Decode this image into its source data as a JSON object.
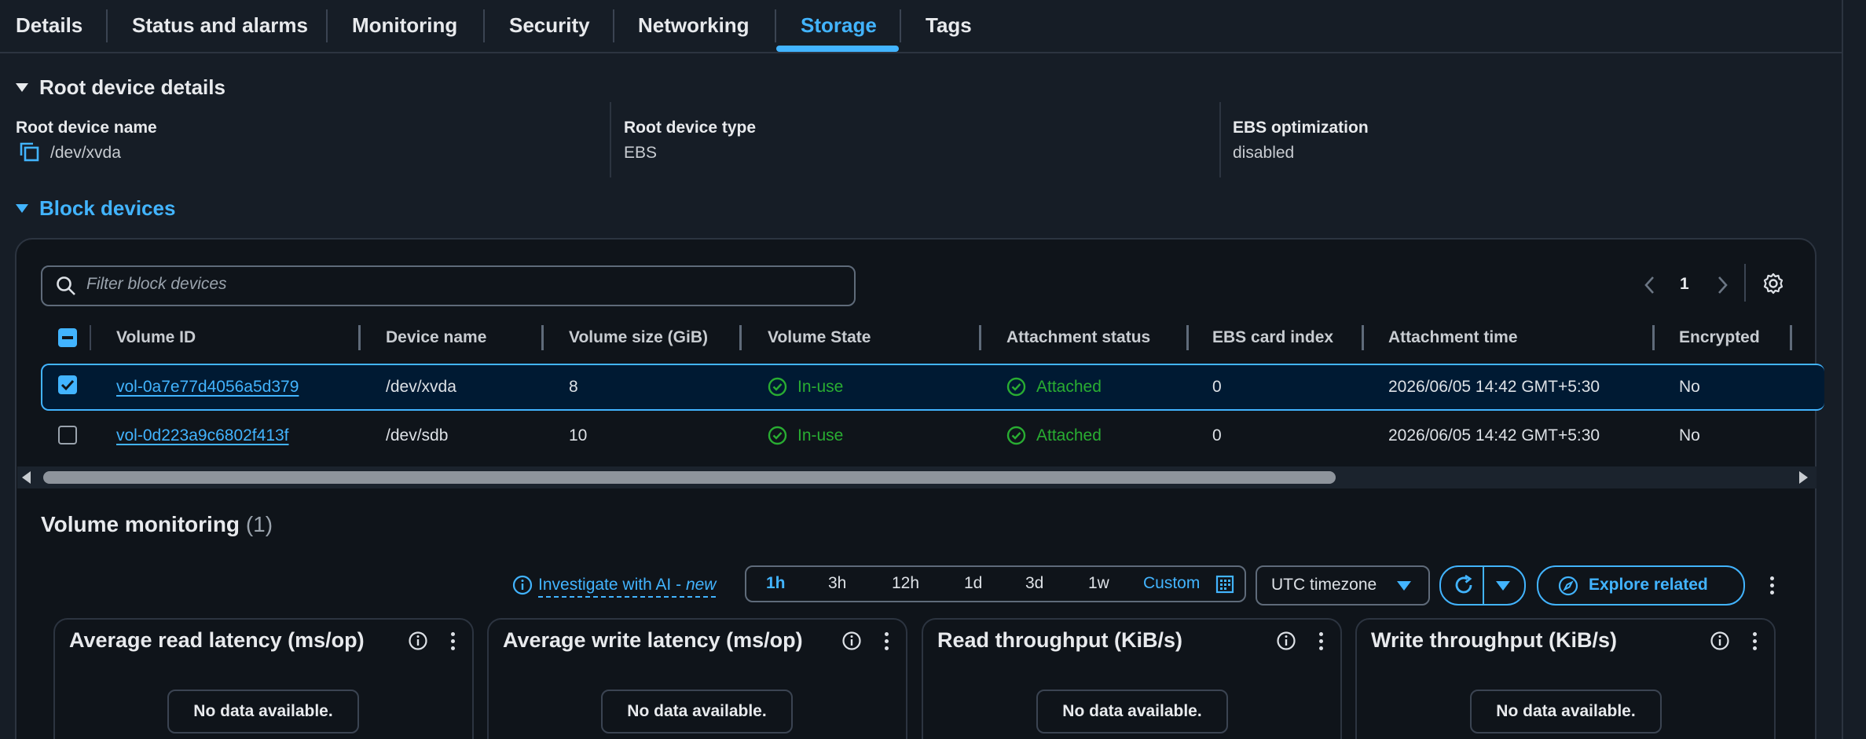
{
  "tabs": [
    {
      "label": "Details"
    },
    {
      "label": "Status and alarms"
    },
    {
      "label": "Monitoring"
    },
    {
      "label": "Security"
    },
    {
      "label": "Networking"
    },
    {
      "label": "Storage",
      "active": true
    },
    {
      "label": "Tags"
    }
  ],
  "root_device": {
    "title": "Root device details",
    "fields": [
      {
        "label": "Root device name",
        "value": "/dev/xvda"
      },
      {
        "label": "Root device type",
        "value": "EBS"
      },
      {
        "label": "EBS optimization",
        "value": "disabled"
      }
    ]
  },
  "block_devices": {
    "title": "Block devices",
    "search_placeholder": "Filter block devices",
    "page": "1",
    "columns": [
      "Volume ID",
      "Device name",
      "Volume size (GiB)",
      "Volume State",
      "Attachment status",
      "EBS card index",
      "Attachment time",
      "Encrypted"
    ],
    "rows": [
      {
        "selected": true,
        "volume_id": "vol-0a7e77d4056a5d379",
        "device": "/dev/xvda",
        "size": "8",
        "state": "In-use",
        "attachment": "Attached",
        "card_index": "0",
        "time": "2026/06/05 14:42 GMT+5:30",
        "encrypted": "No"
      },
      {
        "selected": false,
        "volume_id": "vol-0d223a9c6802f413f",
        "device": "/dev/sdb",
        "size": "10",
        "state": "In-use",
        "attachment": "Attached",
        "card_index": "0",
        "time": "2026/06/05 14:42 GMT+5:30",
        "encrypted": "No"
      }
    ]
  },
  "volume_monitoring": {
    "title": "Volume monitoring",
    "count": "(1)",
    "investigate": "Investigate with AI - ",
    "investigate_new": "new",
    "ranges": [
      "1h",
      "3h",
      "12h",
      "1d",
      "3d",
      "1w"
    ],
    "custom": "Custom",
    "timezone": "UTC timezone",
    "explore": "Explore related",
    "cards": [
      {
        "title": "Average read latency (ms/op)",
        "empty": "No data available."
      },
      {
        "title": "Average write latency (ms/op)",
        "empty": "No data available."
      },
      {
        "title": "Read throughput (KiB/s)",
        "empty": "No data available."
      },
      {
        "title": "Write throughput (KiB/s)",
        "empty": "No data available."
      }
    ]
  },
  "colors": {
    "accent": "#42b4ff",
    "success": "#29ad32",
    "background": "#161d26"
  }
}
